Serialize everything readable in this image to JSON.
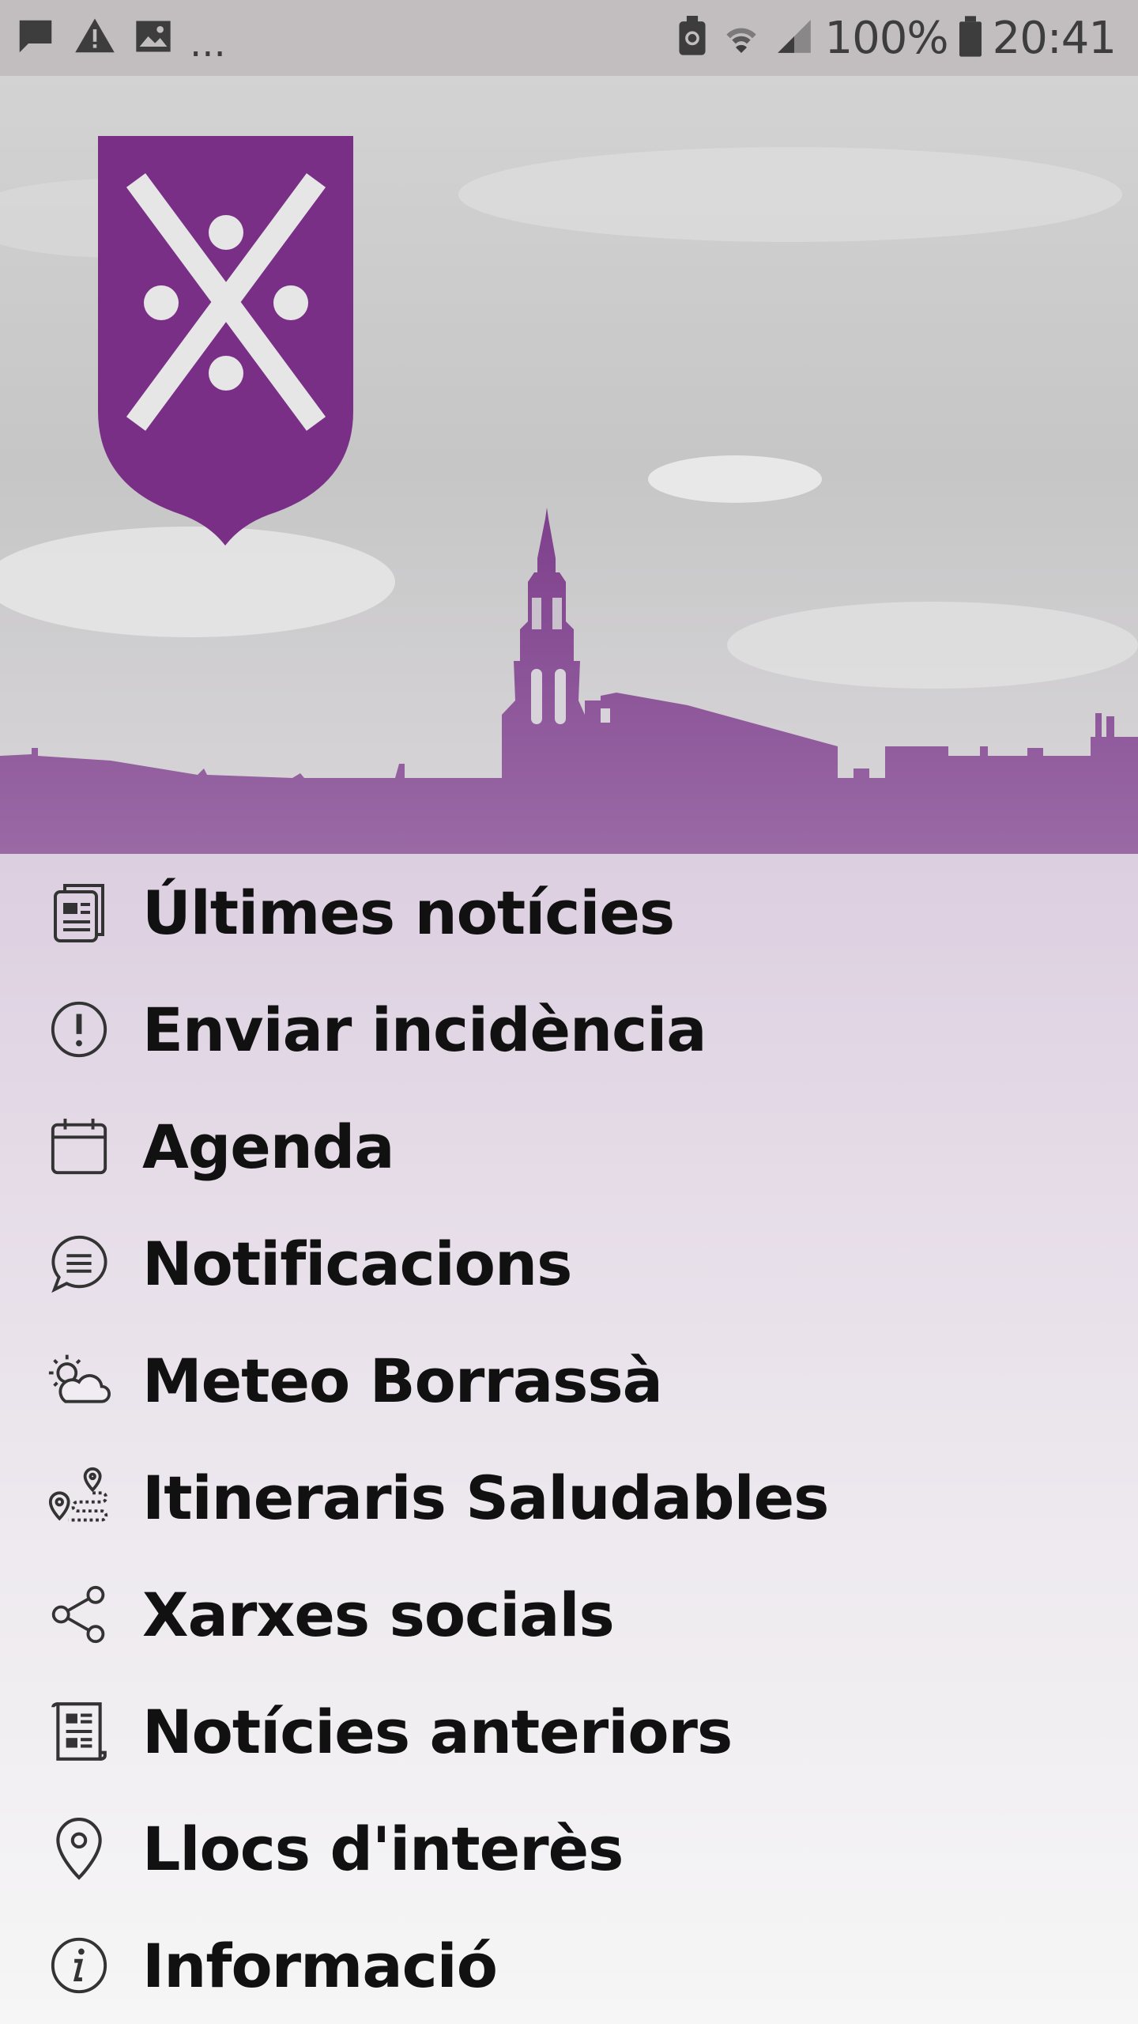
{
  "status_bar": {
    "left_icons": [
      "message-icon",
      "warning-icon",
      "image-icon"
    ],
    "overflow": "...",
    "right_icons": [
      "battery-saver-icon",
      "wifi-icon",
      "cell-signal-icon",
      "battery-icon"
    ],
    "battery": "100%",
    "time": "20:41"
  },
  "header": {
    "brand_color": "#7a2f87",
    "skyline_color": "#8a4a95"
  },
  "menu": {
    "items": [
      {
        "label": "Últimes notícies",
        "icon": "newspaper-icon"
      },
      {
        "label": "Enviar incidència",
        "icon": "alert-circle-icon"
      },
      {
        "label": "Agenda",
        "icon": "calendar-icon"
      },
      {
        "label": "Notificacions",
        "icon": "chat-bubble-icon"
      },
      {
        "label": "Meteo Borrassà",
        "icon": "weather-icon"
      },
      {
        "label": "Itineraris Saludables",
        "icon": "route-icon"
      },
      {
        "label": "Xarxes socials",
        "icon": "share-icon"
      },
      {
        "label": "Notícies anteriors",
        "icon": "archive-news-icon"
      },
      {
        "label": "Llocs d'interès",
        "icon": "map-pin-icon"
      },
      {
        "label": "Informació",
        "icon": "info-icon"
      }
    ]
  }
}
